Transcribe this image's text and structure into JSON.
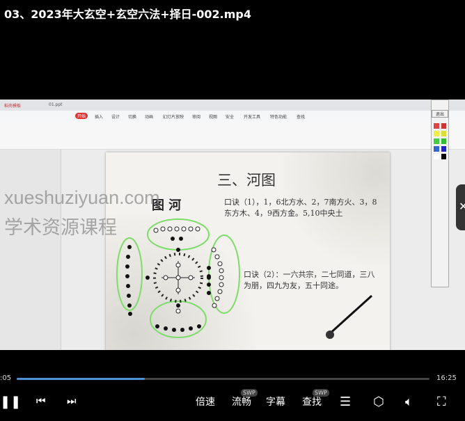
{
  "title": "03、2023年大玄空+玄空六法+择日-002.mp4",
  "app": {
    "tabs": [
      "稻壳模板",
      "01.ppt"
    ],
    "menu": [
      "开始",
      "插入",
      "设计",
      "切换",
      "动画",
      "幻灯片放映",
      "审阅",
      "视图",
      "安全",
      "开发工具",
      "特色功能",
      "查找"
    ],
    "tool_exit": "退出"
  },
  "slide": {
    "title": "三、河图",
    "diagram_label": "图 河",
    "verse1": "口诀（1），1，6北方水、2，7南方火、3，8东方木、4，9西方金。5,10中央土",
    "verse2": "口诀（2）：一六共宗，二七同道，三八为朋，四九为友，五十同途。"
  },
  "watermark": {
    "line1": "xueshuziyuan.com",
    "line2": "学术资源课程"
  },
  "player": {
    "current_time": ":05",
    "duration": "16:25",
    "progress_percent": 31,
    "buttons": {
      "speed": "倍速",
      "quality": "流畅",
      "subtitle": "字幕",
      "search": "查找"
    },
    "badge": "SWP",
    "accent": "#4f8fd6"
  }
}
